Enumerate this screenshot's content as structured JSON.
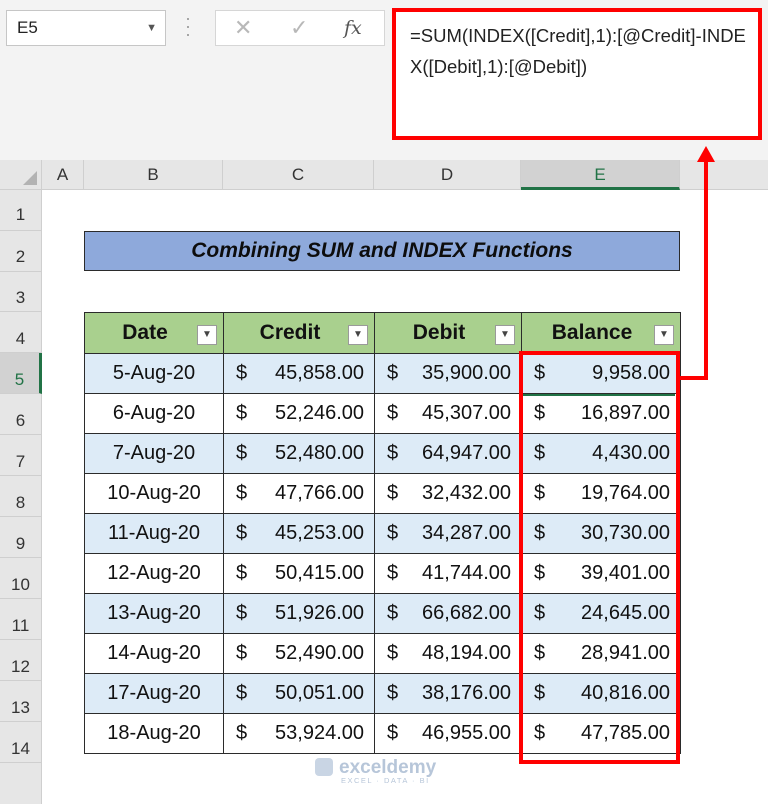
{
  "formula_bar": {
    "name_box": "E5",
    "cancel_glyph": "✕",
    "enter_glyph": "✓",
    "fx_label": "fx",
    "formula": "=SUM(INDEX([Credit],1):[@Credit]-INDEX([Debit],1):[@Debit])"
  },
  "columns": [
    "A",
    "B",
    "C",
    "D",
    "E"
  ],
  "rows": [
    "1",
    "2",
    "3",
    "4",
    "5",
    "6",
    "7",
    "8",
    "9",
    "10",
    "11",
    "12",
    "13",
    "14"
  ],
  "selected_column": "E",
  "selected_row": "5",
  "title": "Combining SUM and INDEX Functions",
  "table": {
    "headers": [
      "Date",
      "Credit",
      "Debit",
      "Balance"
    ],
    "currency": "$",
    "rows": [
      {
        "date": "5-Aug-20",
        "credit": "45,858.00",
        "debit": "35,900.00",
        "balance": "9,958.00"
      },
      {
        "date": "6-Aug-20",
        "credit": "52,246.00",
        "debit": "45,307.00",
        "balance": "16,897.00"
      },
      {
        "date": "7-Aug-20",
        "credit": "52,480.00",
        "debit": "64,947.00",
        "balance": "4,430.00"
      },
      {
        "date": "10-Aug-20",
        "credit": "47,766.00",
        "debit": "32,432.00",
        "balance": "19,764.00"
      },
      {
        "date": "11-Aug-20",
        "credit": "45,253.00",
        "debit": "34,287.00",
        "balance": "30,730.00"
      },
      {
        "date": "12-Aug-20",
        "credit": "50,415.00",
        "debit": "41,744.00",
        "balance": "39,401.00"
      },
      {
        "date": "13-Aug-20",
        "credit": "51,926.00",
        "debit": "66,682.00",
        "balance": "24,645.00"
      },
      {
        "date": "14-Aug-20",
        "credit": "52,490.00",
        "debit": "48,194.00",
        "balance": "28,941.00"
      },
      {
        "date": "17-Aug-20",
        "credit": "50,051.00",
        "debit": "38,176.00",
        "balance": "40,816.00"
      },
      {
        "date": "18-Aug-20",
        "credit": "53,924.00",
        "debit": "46,955.00",
        "balance": "47,785.00"
      }
    ]
  },
  "watermark": {
    "brand": "exceldemy",
    "tagline": "EXCEL · DATA · BI"
  },
  "colors": {
    "highlight": "#ff0000",
    "header_fill": "#a9d08e",
    "title_fill": "#8ea9db",
    "band_fill": "#ddebf7",
    "selection": "#217346"
  }
}
